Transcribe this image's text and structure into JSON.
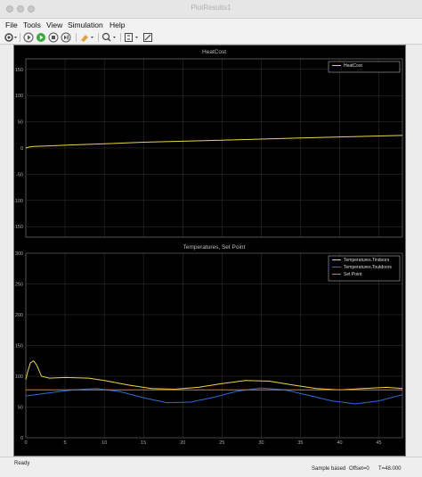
{
  "window": {
    "title": "PlotResults1"
  },
  "menu": [
    "File",
    "Tools",
    "View",
    "Simulation",
    "Help"
  ],
  "toolbar": {
    "icons": [
      "settings-icon",
      "play-icon",
      "run-icon",
      "stop-icon",
      "highlight-icon",
      "zoom-icon",
      "fit-icon",
      "style-icon"
    ]
  },
  "status": {
    "left": "Ready",
    "mode": "Sample based",
    "offset": "Offset=0",
    "time": "T=48.000"
  },
  "chart_data": [
    {
      "type": "line",
      "title": "HeatCost",
      "ylim": [
        -170,
        170
      ],
      "xlim": [
        0,
        48
      ],
      "yticks": [
        150,
        100,
        50,
        0,
        -50,
        -100,
        -150
      ],
      "xticks": [],
      "grid": true,
      "legend_position": "top-right",
      "series": [
        {
          "name": "HeatCost",
          "color": "#e8d44a",
          "x": [
            0,
            0.5,
            1,
            3,
            6,
            10,
            15,
            20,
            25,
            30,
            35,
            40,
            45,
            48
          ],
          "y": [
            0,
            2,
            3,
            4,
            6,
            8,
            11,
            13,
            15,
            17,
            19,
            21,
            23,
            24
          ]
        }
      ]
    },
    {
      "type": "line",
      "title": "Temperatures, Set Point",
      "ylim": [
        0,
        300
      ],
      "xlim": [
        0,
        48
      ],
      "yticks": [
        300,
        250,
        200,
        150,
        100,
        50,
        0
      ],
      "xticks": [
        0,
        5,
        10,
        15,
        20,
        25,
        30,
        35,
        40,
        45
      ],
      "grid": true,
      "legend_position": "top-right",
      "series": [
        {
          "name": "Temperatures.Tindoors",
          "color": "#e8d44a",
          "x": [
            0,
            0.3,
            0.6,
            1,
            1.4,
            2,
            3,
            5,
            8,
            10,
            13,
            16,
            19,
            22,
            25,
            28,
            31,
            34,
            37,
            40,
            43,
            46,
            48
          ],
          "y": [
            95,
            110,
            122,
            125,
            118,
            100,
            97,
            98,
            97,
            93,
            86,
            80,
            79,
            82,
            88,
            93,
            92,
            86,
            80,
            78,
            80,
            82,
            80
          ]
        },
        {
          "name": "Temperatures.Toutdoors",
          "color": "#2f6bd8",
          "x": [
            0,
            3,
            6,
            9,
            12,
            15,
            18,
            21,
            24,
            27,
            30,
            33,
            36,
            39,
            42,
            45,
            48
          ],
          "y": [
            68,
            73,
            78,
            80,
            75,
            65,
            57,
            58,
            66,
            76,
            81,
            78,
            69,
            60,
            55,
            60,
            70
          ]
        },
        {
          "name": "Set Point",
          "color": "#e07a2f",
          "x": [
            0,
            10,
            20,
            30,
            40,
            48
          ],
          "y": [
            78,
            78,
            78,
            78,
            78,
            78
          ]
        }
      ]
    }
  ]
}
